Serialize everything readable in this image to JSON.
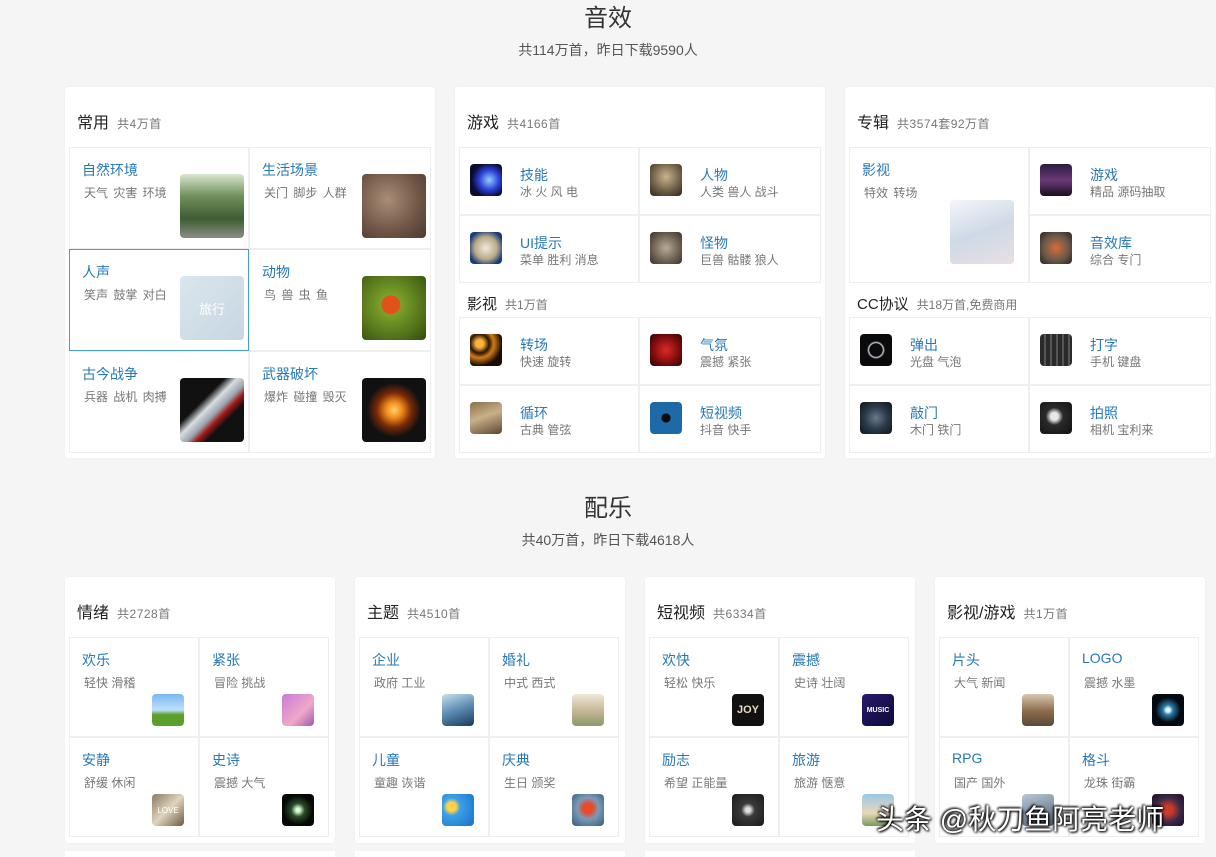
{
  "sfx": {
    "title": "音效",
    "subtitle": "共114万首，昨日下载9590人",
    "common": {
      "title": "常用",
      "count": "共4万首",
      "items": [
        {
          "title": "自然环境",
          "tags": "天气 灾害 环境"
        },
        {
          "title": "生活场景",
          "tags": "关门 脚步 人群"
        },
        {
          "title": "人声",
          "tags": "笑声 鼓掌 对白",
          "thumb_text": "旅行"
        },
        {
          "title": "动物",
          "tags": "鸟 兽 虫 鱼"
        },
        {
          "title": "古今战争",
          "tags": "兵器 战机 肉搏"
        },
        {
          "title": "武器破坏",
          "tags": "爆炸 碰撞 毁灭"
        }
      ]
    },
    "game": {
      "title": "游戏",
      "count": "共4166首",
      "items": [
        {
          "title": "技能",
          "tags": "冰 火 风 电"
        },
        {
          "title": "人物",
          "tags": "人类 兽人 战斗"
        },
        {
          "title": "UI提示",
          "tags": "菜单 胜利 消息"
        },
        {
          "title": "怪物",
          "tags": "巨兽 骷髅 狼人"
        }
      ]
    },
    "film": {
      "title": "影视",
      "count": "共1万首",
      "items": [
        {
          "title": "转场",
          "tags": "快速 旋转"
        },
        {
          "title": "气氛",
          "tags": "震撼 紧张"
        },
        {
          "title": "循环",
          "tags": "古典 管弦"
        },
        {
          "title": "短视频",
          "tags": "抖音 快手"
        }
      ]
    },
    "album": {
      "title": "专辑",
      "count": "共3574套92万首",
      "big": {
        "title": "影视",
        "tags": "特效 转场"
      },
      "items": [
        {
          "title": "游戏",
          "tags": "精品 源码抽取"
        },
        {
          "title": "音效库",
          "tags": "综合 专门"
        }
      ]
    },
    "cc": {
      "title": "CC协议",
      "count": "共18万首,免费商用",
      "items": [
        {
          "title": "弹出",
          "tags": "光盘 气泡"
        },
        {
          "title": "打字",
          "tags": "手机 键盘"
        },
        {
          "title": "敲门",
          "tags": "木门 铁门"
        },
        {
          "title": "拍照",
          "tags": "相机 宝利来"
        }
      ]
    }
  },
  "music": {
    "title": "配乐",
    "subtitle": "共40万首，昨日下载4618人",
    "cards": [
      {
        "title": "情绪",
        "count": "共2728首",
        "items": [
          {
            "title": "欢乐",
            "tags": "轻快 滑稽"
          },
          {
            "title": "紧张",
            "tags": "冒险 挑战"
          },
          {
            "title": "安静",
            "tags": "舒缓 休闲"
          },
          {
            "title": "史诗",
            "tags": "震撼 大气"
          }
        ]
      },
      {
        "title": "主题",
        "count": "共4510首",
        "items": [
          {
            "title": "企业",
            "tags": "政府 工业"
          },
          {
            "title": "婚礼",
            "tags": "中式 西式"
          },
          {
            "title": "儿童",
            "tags": "童趣 诙谐"
          },
          {
            "title": "庆典",
            "tags": "生日 颁奖"
          }
        ]
      },
      {
        "title": "短视频",
        "count": "共6334首",
        "items": [
          {
            "title": "欢快",
            "tags": "轻松 快乐"
          },
          {
            "title": "震撼",
            "tags": "史诗 壮阔"
          },
          {
            "title": "励志",
            "tags": "希望 正能量"
          },
          {
            "title": "旅游",
            "tags": "旅游 惬意"
          }
        ]
      },
      {
        "title": "影视/游戏",
        "count": "共1万首",
        "items": [
          {
            "title": "片头",
            "tags": "大气 新闻"
          },
          {
            "title": "LOGO",
            "tags": "震撼 水墨"
          },
          {
            "title": "RPG",
            "tags": "国产 国外"
          },
          {
            "title": "格斗",
            "tags": "龙珠 街霸"
          }
        ]
      }
    ]
  },
  "thumb_labels": {
    "joy": "JOY",
    "music": "MUSIC",
    "love": "LOVE"
  },
  "watermark": "头条 @秋刀鱼阿亮老师"
}
